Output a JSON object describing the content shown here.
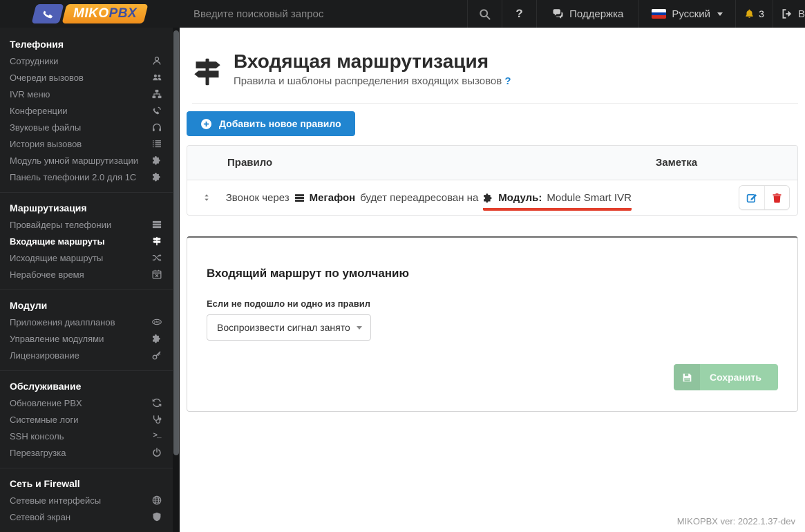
{
  "topbar": {
    "brand_miko": "MIKO",
    "brand_pbx": "PBX",
    "search_placeholder": "Введите поисковый запрос",
    "help_label": "?",
    "support_label": "Поддержка",
    "language_label": "Русский",
    "notifications_count": "3",
    "logout_label": "В"
  },
  "sidebar": {
    "sections": [
      {
        "title": "Телефония",
        "items": [
          {
            "label": "Сотрудники"
          },
          {
            "label": "Очереди вызовов"
          },
          {
            "label": "IVR меню"
          },
          {
            "label": "Конференции"
          },
          {
            "label": "Звуковые файлы"
          },
          {
            "label": "История вызовов"
          },
          {
            "label": "Модуль умной маршрутизации"
          },
          {
            "label": "Панель телефонии 2.0 для 1С"
          }
        ]
      },
      {
        "title": "Маршрутизация",
        "items": [
          {
            "label": "Провайдеры телефонии"
          },
          {
            "label": "Входящие маршруты"
          },
          {
            "label": "Исходящие маршруты"
          },
          {
            "label": "Нерабочее время"
          }
        ]
      },
      {
        "title": "Модули",
        "items": [
          {
            "label": "Приложения диалпланов"
          },
          {
            "label": "Управление модулями"
          },
          {
            "label": "Лицензирование"
          }
        ]
      },
      {
        "title": "Обслуживание",
        "items": [
          {
            "label": "Обновление PBX"
          },
          {
            "label": "Системные логи"
          },
          {
            "label": "SSH консоль"
          },
          {
            "label": "Перезагрузка"
          }
        ]
      },
      {
        "title": "Сеть и Firewall",
        "items": [
          {
            "label": "Сетевые интерфейсы"
          },
          {
            "label": "Сетевой экран"
          }
        ]
      }
    ]
  },
  "main": {
    "header": {
      "title": "Входящая маршрутизация",
      "subtitle": "Правила и шаблоны распределения входящих вызовов",
      "help": "?"
    },
    "add_button_label": "Добавить новое правило",
    "table": {
      "columns": [
        "Правило",
        "Заметка"
      ],
      "rule": {
        "text_before": "Звонок через",
        "provider": "Мегафон",
        "text_middle": "будет переадресован на",
        "dest_label": "Модуль:",
        "dest_value": "Module Smart IVR"
      }
    },
    "default_route": {
      "title": "Входящий маршрут по умолчанию",
      "field_label": "Если не подошло ни одно из правил",
      "select_value": "Воспроизвести сигнал занято",
      "save_label": "Сохранить"
    },
    "footer_version": "MIKOPBX ver: 2022.1.37-dev"
  },
  "colors": {
    "accent_blue": "#2185d0",
    "danger_red": "#db2828",
    "underline_red": "#e23e2b",
    "bell_gold": "#dda910",
    "save_green_disabled": "#9ad2a9",
    "flag_white": "#ffffff",
    "flag_blue": "#0039a6",
    "flag_red": "#d52b1e"
  }
}
